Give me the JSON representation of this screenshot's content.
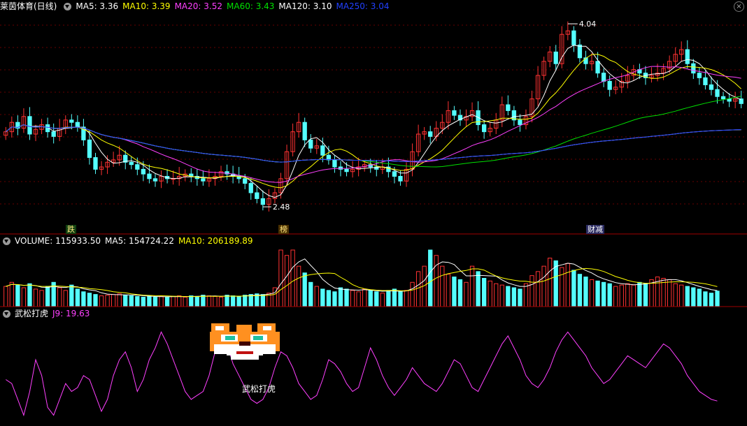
{
  "price_header": {
    "title": "莱茵体育(日线)",
    "ma5": "MA5: 3.36",
    "ma10": "MA10: 3.39",
    "ma20": "MA20: 3.52",
    "ma60": "MA60: 3.43",
    "ma120": "MA120: 3.10",
    "ma250": "MA250: 3.04"
  },
  "volume_header": {
    "volume": "VOLUME: 115933.50",
    "ma5": "MA5: 154724.22",
    "ma10": "MA10: 206189.89"
  },
  "indicator_header": {
    "name": "武松打虎",
    "j": "J9: 19.63"
  },
  "annotations": {
    "high_label": "4.04",
    "low_label": "2.48",
    "tag_die": "跌",
    "tag_bang": "榜",
    "tag_caijian": "财减",
    "indicator_text": "武松打虎"
  },
  "colors": {
    "up": "#ff3232",
    "down": "#54ffff",
    "ma5": "#ffffff",
    "ma10": "#ffff00",
    "ma20": "#ff40ff",
    "ma60": "#00e000",
    "ma120": "#ffffff",
    "ma250": "#2040ff",
    "j_line": "#ff40ff",
    "grid": "#8b0000"
  },
  "chart_data": [
    {
      "type": "candlestick",
      "title": "莱茵体育(日线)",
      "ylim": [
        2.35,
        4.1
      ],
      "high": 4.04,
      "low": 2.48,
      "close": [
        3.12,
        3.2,
        3.15,
        3.25,
        3.1,
        3.14,
        3.18,
        3.12,
        3.08,
        3.15,
        3.22,
        3.2,
        3.16,
        3.05,
        2.9,
        2.8,
        2.82,
        2.86,
        2.88,
        2.92,
        2.86,
        2.84,
        2.8,
        2.76,
        2.72,
        2.7,
        2.74,
        2.72,
        2.72,
        2.74,
        2.76,
        2.74,
        2.72,
        2.7,
        2.72,
        2.74,
        2.78,
        2.76,
        2.74,
        2.72,
        2.68,
        2.6,
        2.55,
        2.5,
        2.55,
        2.6,
        2.72,
        2.95,
        3.12,
        3.2,
        3.05,
        2.98,
        3.0,
        2.92,
        2.88,
        2.82,
        2.8,
        2.78,
        2.8,
        2.82,
        2.84,
        2.82,
        2.8,
        2.82,
        2.78,
        2.74,
        2.7,
        2.8,
        2.95,
        3.1,
        3.12,
        3.08,
        3.15,
        3.2,
        3.3,
        3.26,
        3.22,
        3.25,
        3.3,
        3.18,
        3.12,
        3.15,
        3.22,
        3.35,
        3.3,
        3.22,
        3.18,
        3.25,
        3.4,
        3.6,
        3.72,
        3.8,
        3.7,
        3.95,
        3.98,
        3.86,
        3.75,
        3.7,
        3.72,
        3.62,
        3.55,
        3.48,
        3.5,
        3.55,
        3.6,
        3.65,
        3.62,
        3.58,
        3.6,
        3.62,
        3.66,
        3.72,
        3.78,
        3.82,
        3.7,
        3.62,
        3.58,
        3.52,
        3.48,
        3.42,
        3.4,
        3.38,
        3.4,
        3.36
      ],
      "series": [
        {
          "name": "MA5"
        },
        {
          "name": "MA10"
        },
        {
          "name": "MA20"
        },
        {
          "name": "MA60"
        },
        {
          "name": "MA120"
        },
        {
          "name": "MA250"
        }
      ]
    },
    {
      "type": "bar",
      "title": "VOLUME",
      "values": [
        150,
        180,
        160,
        140,
        170,
        130,
        120,
        150,
        180,
        140,
        120,
        160,
        130,
        110,
        100,
        90,
        80,
        85,
        90,
        95,
        85,
        80,
        75,
        70,
        80,
        70,
        75,
        70,
        75,
        80,
        70,
        80,
        75,
        85,
        80,
        75,
        70,
        85,
        80,
        75,
        85,
        90,
        95,
        90,
        100,
        140,
        420,
        380,
        420,
        300,
        250,
        180,
        150,
        130,
        120,
        110,
        140,
        130,
        120,
        110,
        130,
        120,
        110,
        100,
        120,
        130,
        110,
        120,
        180,
        260,
        300,
        420,
        380,
        300,
        240,
        220,
        200,
        180,
        300,
        260,
        210,
        190,
        170,
        160,
        150,
        140,
        130,
        170,
        230,
        260,
        300,
        360,
        340,
        290,
        320,
        270,
        240,
        220,
        200,
        190,
        180,
        170,
        150,
        160,
        170,
        160,
        180,
        170,
        200,
        220,
        210,
        200,
        170,
        160,
        150,
        140,
        130,
        110,
        100,
        115
      ]
    },
    {
      "type": "line",
      "title": "武松打虎",
      "series": [
        {
          "name": "J9"
        }
      ],
      "values": [
        55,
        50,
        30,
        10,
        40,
        80,
        60,
        20,
        10,
        30,
        50,
        40,
        45,
        60,
        55,
        35,
        15,
        30,
        60,
        80,
        90,
        70,
        40,
        55,
        80,
        95,
        115,
        100,
        80,
        60,
        40,
        30,
        35,
        40,
        60,
        90,
        120,
        100,
        75,
        60,
        45,
        30,
        25,
        30,
        45,
        70,
        90,
        85,
        70,
        50,
        40,
        30,
        35,
        55,
        80,
        75,
        65,
        50,
        40,
        45,
        70,
        95,
        80,
        60,
        45,
        35,
        45,
        55,
        70,
        60,
        50,
        45,
        40,
        50,
        65,
        80,
        75,
        60,
        45,
        40,
        55,
        70,
        85,
        100,
        110,
        95,
        80,
        60,
        50,
        45,
        55,
        70,
        90,
        105,
        115,
        105,
        95,
        85,
        70,
        60,
        50,
        55,
        65,
        75,
        85,
        80,
        75,
        70,
        80,
        90,
        100,
        95,
        85,
        75,
        60,
        50,
        40,
        35,
        30,
        28
      ]
    }
  ]
}
